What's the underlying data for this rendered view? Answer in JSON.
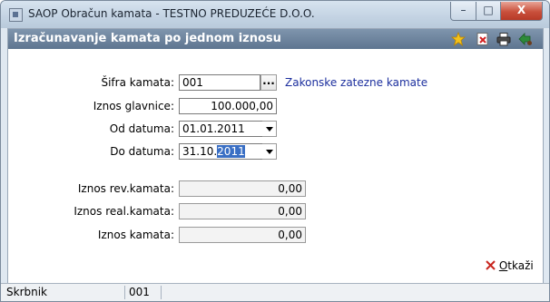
{
  "window": {
    "title": "SAOP Obračun kamata - TESTNO PREDUZEĆE D.O.O.",
    "minimize_glyph": "–",
    "maximize_glyph": "□",
    "close_glyph": "X"
  },
  "header": {
    "title": "Izračunavanje kamata po jednom iznosu",
    "icons": [
      "star-icon",
      "close-document-icon",
      "printer-icon",
      "exit-icon"
    ]
  },
  "form": {
    "sifra_kamata": {
      "label": "Šifra kamata:",
      "value": "001",
      "lookup_button": "...",
      "description": "Zakonske zatezne kamate"
    },
    "iznos_glavnice": {
      "label": "Iznos glavnice:",
      "value": "100.000,00"
    },
    "od_datuma": {
      "label": "Od datuma:",
      "value": "01.01.2011"
    },
    "do_datuma": {
      "label": "Do datuma:",
      "value_prefix": "31.10.",
      "value_selected": "2011"
    },
    "iznos_rev_kamata": {
      "label": "Iznos rev.kamata:",
      "value": "0,00"
    },
    "iznos_real_kamata": {
      "label": "Iznos real.kamata:",
      "value": "0,00"
    },
    "iznos_kamata": {
      "label": "Iznos kamata:",
      "value": "0,00"
    }
  },
  "actions": {
    "cancel_icon": "x-icon",
    "cancel_label_underlined": "O",
    "cancel_label_rest": "tkaži"
  },
  "statusbar": {
    "user_label": "Skrbnik",
    "user_code": "001"
  },
  "colors": {
    "header_bar": "#5e7590",
    "link": "#1c2f9e",
    "selection": "#3a6fc4",
    "close_button": "#c9503c"
  }
}
